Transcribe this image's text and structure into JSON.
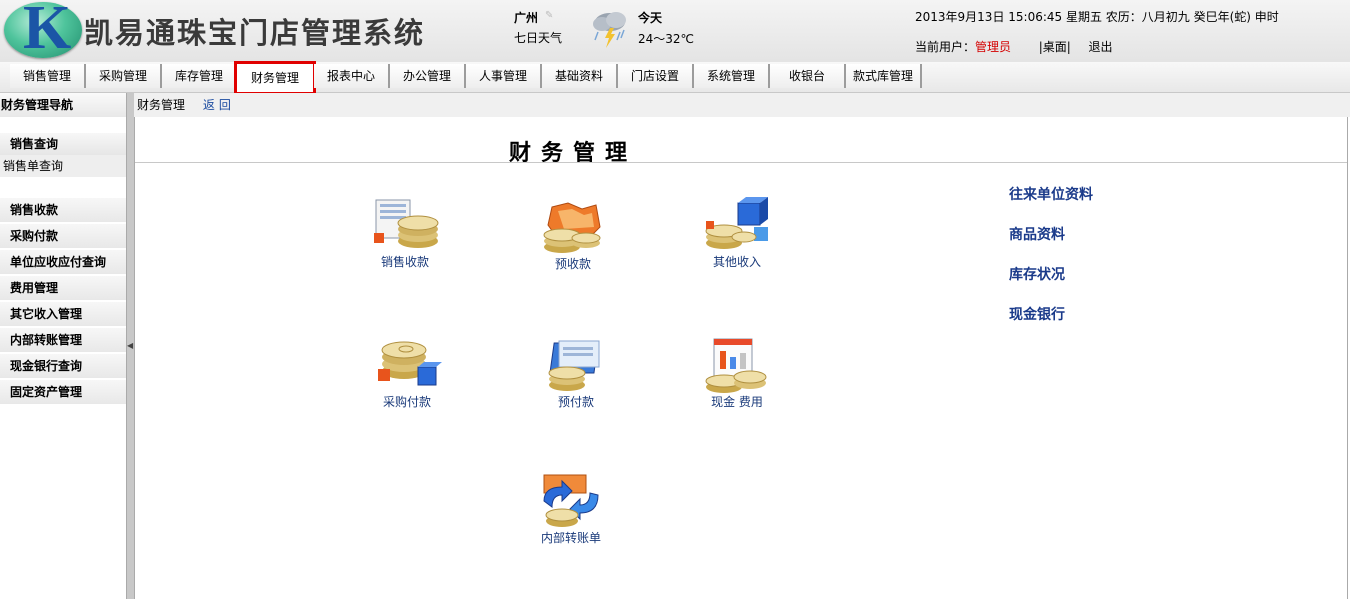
{
  "header": {
    "logo_letter": "K",
    "system_title": "凯易通珠宝门店管理系统",
    "city": "广州",
    "forecast_link": "七日天气",
    "today_label": "今天",
    "temperature": "24～32℃",
    "datetime": "2013年9月13日  15:06:45 星期五  农历：八月初九  癸巳年(蛇) 申时",
    "current_user_label": "当前用户：",
    "current_user": "管理员",
    "desktop_link": "|桌面|",
    "logout_link": "退出"
  },
  "menu": {
    "items": [
      {
        "label": "销售管理"
      },
      {
        "label": "采购管理"
      },
      {
        "label": "库存管理"
      },
      {
        "label": "财务管理"
      },
      {
        "label": "报表中心"
      },
      {
        "label": "办公管理"
      },
      {
        "label": "人事管理"
      },
      {
        "label": "基础资料"
      },
      {
        "label": "门店设置"
      },
      {
        "label": "系统管理"
      },
      {
        "label": "收银台"
      },
      {
        "label": "款式库管理"
      }
    ],
    "active_index": 3
  },
  "sidebar": {
    "title": "财务管理导航",
    "group1": "销售查询",
    "sub1": "销售单查询",
    "items": [
      {
        "label": "销售收款"
      },
      {
        "label": "采购付款"
      },
      {
        "label": "单位应收应付查询"
      },
      {
        "label": "费用管理"
      },
      {
        "label": "其它收入管理"
      },
      {
        "label": "内部转账管理"
      },
      {
        "label": "现金银行查询"
      },
      {
        "label": "固定资产管理"
      }
    ]
  },
  "breadcrumb": {
    "current": "财务管理",
    "back": "返回"
  },
  "main": {
    "page_title": "财务管理",
    "tiles": [
      {
        "label": "销售收款",
        "icon": "sales-receipt-icon"
      },
      {
        "label": "预收款",
        "icon": "advance-receipt-icon"
      },
      {
        "label": "其他收入",
        "icon": "other-income-icon"
      },
      {
        "label": "采购付款",
        "icon": "purchase-payment-icon"
      },
      {
        "label": "预付款",
        "icon": "prepayment-icon"
      },
      {
        "label": "现金 费用",
        "icon": "cash-expense-icon"
      },
      {
        "label": "内部转账单",
        "icon": "internal-transfer-icon"
      }
    ],
    "quick_links": [
      {
        "label": "往来单位资料"
      },
      {
        "label": "商品资料"
      },
      {
        "label": "库存状况"
      },
      {
        "label": "现金银行"
      }
    ]
  },
  "colors": {
    "menu_active_border": "#e00000",
    "current_user": "#d40000",
    "link_blue": "#1a3a8a"
  }
}
